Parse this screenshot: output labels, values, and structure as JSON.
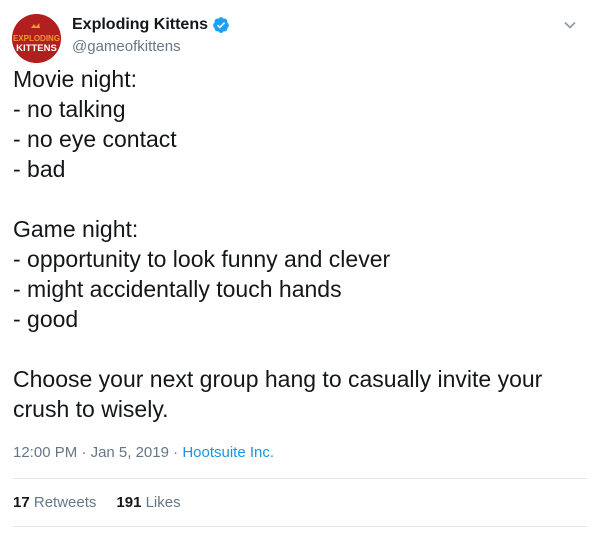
{
  "author": {
    "display_name": "Exploding Kittens",
    "handle": "@gameofkittens",
    "verified_icon": "verified-badge-icon",
    "avatar_text_top": "EXPLODING",
    "avatar_text_bottom": "KITTENS",
    "avatar_color": "#b11f1f"
  },
  "tweet": {
    "lines_block1": [
      "Movie night:",
      "- no talking",
      "- no eye contact",
      "- bad"
    ],
    "lines_block2": [
      "Game night:",
      "- opportunity to look funny and clever",
      "- might accidentally touch hands",
      "- good"
    ],
    "lines_block3": [
      "Choose your next group hang to casually invite your",
      "crush to wisely."
    ]
  },
  "meta": {
    "time": "12:00 PM",
    "separator": " · ",
    "date": "Jan 5, 2019",
    "source": "Hootsuite Inc."
  },
  "stats": {
    "retweets_count": "17",
    "retweets_label": "Retweets",
    "likes_count": "191",
    "likes_label": "Likes"
  },
  "colors": {
    "link": "#1b95e0",
    "secondary_text": "#657786",
    "primary_text": "#14171a"
  }
}
